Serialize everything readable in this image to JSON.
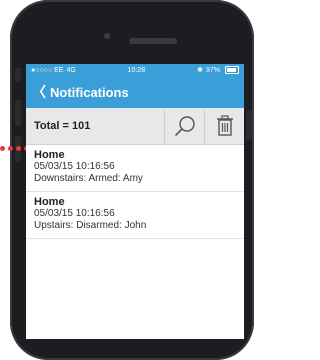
{
  "status_bar": {
    "carrier": "●○○○○ EE",
    "network": "4G",
    "time": "10:28",
    "bluetooth": "✱",
    "battery": "97%"
  },
  "nav": {
    "back_glyph": "〈",
    "title": "Notifications"
  },
  "toolbar": {
    "total_label": "Total = 101",
    "search_icon": "search-icon",
    "trash_icon": "trash-icon"
  },
  "notifications": [
    {
      "title": "Home",
      "timestamp": "05/03/15 10:16:56",
      "message": "Downstairs: Armed: Amy"
    },
    {
      "title": "Home",
      "timestamp": "05/03/15 10:16:56",
      "message": "Upstairs: Disarmed: John"
    }
  ],
  "colors": {
    "accent": "#3a9fd8",
    "toolbar_bg": "#e8e8e8",
    "phone_body": "#1c1d20",
    "indicator_dots": "#e23b3b"
  }
}
